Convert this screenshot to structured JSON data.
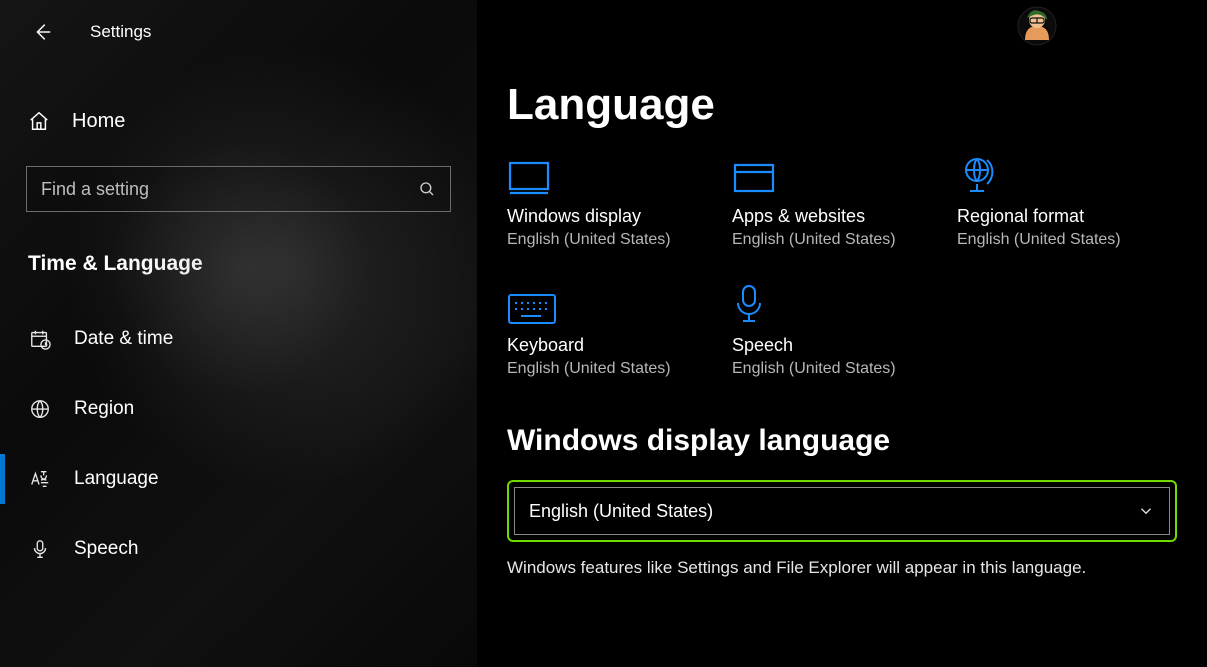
{
  "header": {
    "app_title": "Settings"
  },
  "sidebar": {
    "home_label": "Home",
    "search_placeholder": "Find a setting",
    "section_title": "Time & Language",
    "items": [
      {
        "label": "Date & time",
        "icon": "calendar-clock-icon",
        "selected": false
      },
      {
        "label": "Region",
        "icon": "globe-icon",
        "selected": false
      },
      {
        "label": "Language",
        "icon": "language-az-icon",
        "selected": true
      },
      {
        "label": "Speech",
        "icon": "microphone-icon",
        "selected": false
      }
    ]
  },
  "main": {
    "page_title": "Language",
    "tiles": [
      {
        "label": "Windows display",
        "value": "English (United States)",
        "icon": "display-icon"
      },
      {
        "label": "Apps & websites",
        "value": "English (United States)",
        "icon": "app-window-icon"
      },
      {
        "label": "Regional format",
        "value": "English (United States)",
        "icon": "globe-stand-icon"
      },
      {
        "label": "Keyboard",
        "value": "English (United States)",
        "icon": "keyboard-icon"
      },
      {
        "label": "Speech",
        "value": "English (United States)",
        "icon": "microphone-icon"
      }
    ],
    "subheading": "Windows display language",
    "dropdown_value": "English (United States)",
    "helper_text": "Windows features like Settings and File Explorer will appear in this language."
  },
  "colors": {
    "accent": "#0a84ff",
    "highlight_border": "#6fda00",
    "sidebar_accent": "#0078d4"
  }
}
